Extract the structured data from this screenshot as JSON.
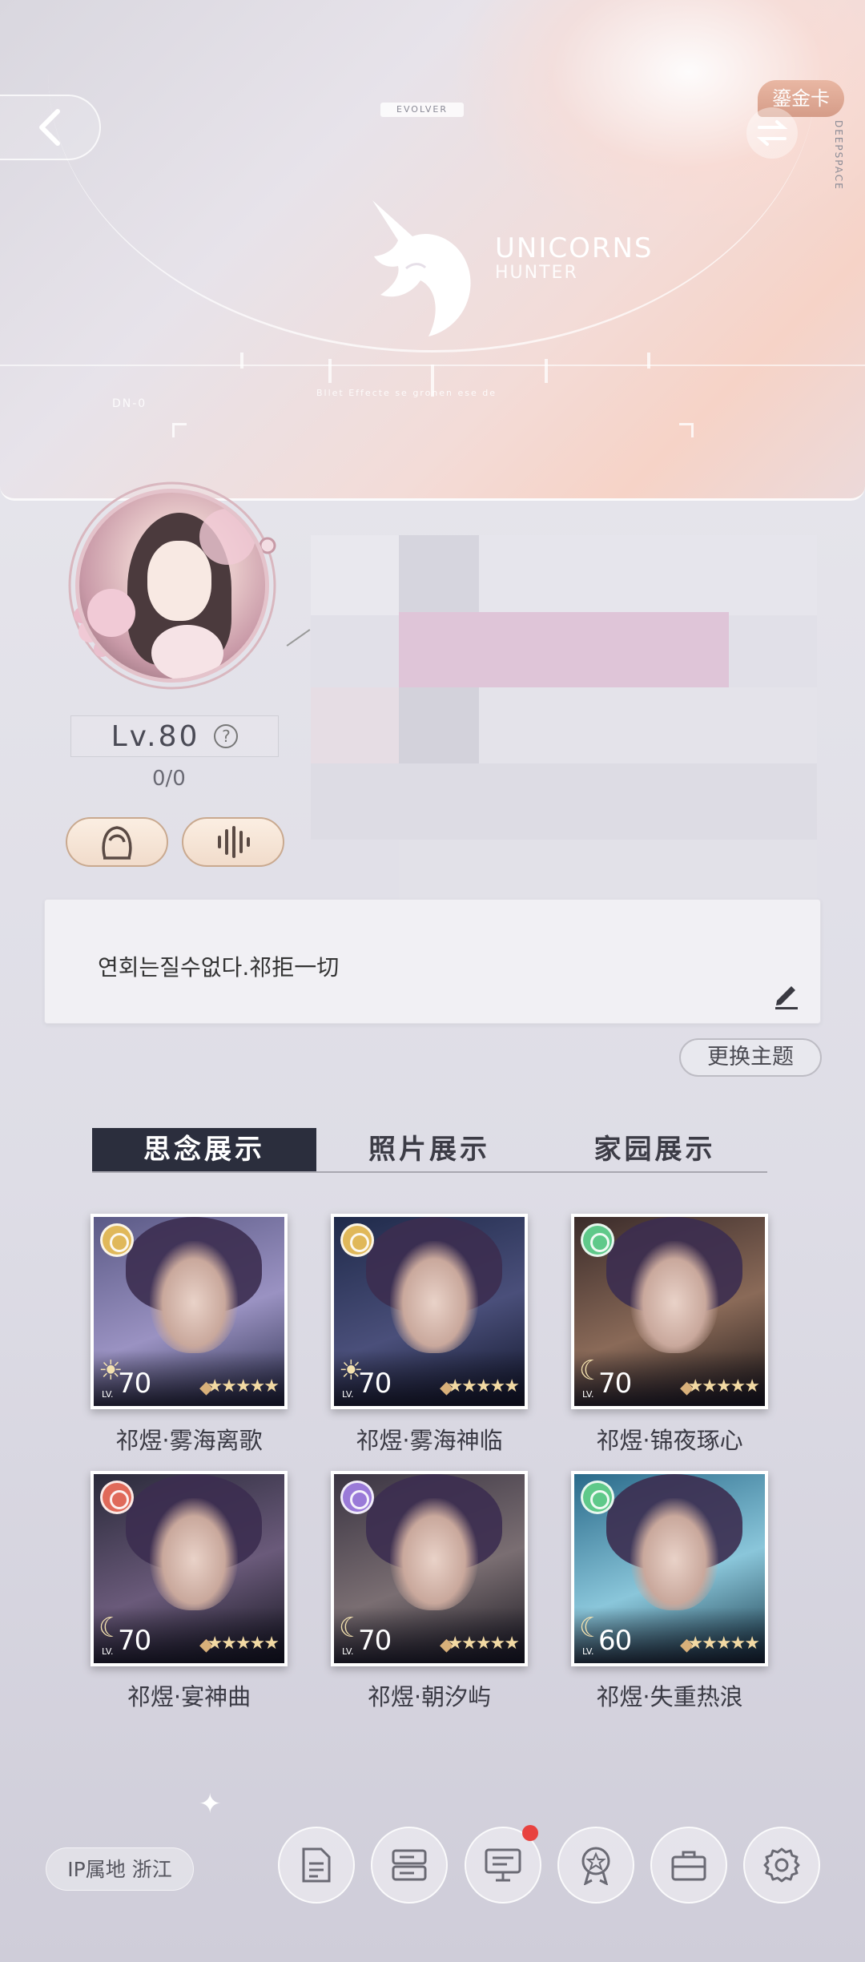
{
  "banner": {
    "evolver_tag": "EVOLVER",
    "logo_title": "UNICORNS",
    "logo_subtitle": "HUNTER",
    "gold_card_label": "鎏金卡",
    "side_text": "DEEPSPACE",
    "readout_left": "DN-0",
    "readout_mid": "Bllet Effecte se gronen ese de"
  },
  "profile": {
    "level": "Lv.80",
    "exp": "0/0"
  },
  "signature": {
    "text": "연회는질수없다.祁拒一切"
  },
  "theme_button": "更换主题",
  "tabs": [
    {
      "label": "思念展示",
      "active": true
    },
    {
      "label": "照片展示",
      "active": false
    },
    {
      "label": "家园展示",
      "active": false
    }
  ],
  "cards": [
    {
      "name": "祁煜·雾海离歌",
      "level": "70",
      "level_icon": "sun-icon",
      "stars": "★★★★★",
      "badge_color": "#e0b85a",
      "art": [
        "#5b5a86",
        "#9a92c2",
        "#2b2e4c"
      ]
    },
    {
      "name": "祁煜·雾海神临",
      "level": "70",
      "level_icon": "sun-icon",
      "stars": "★★★★★",
      "badge_color": "#e0b85a",
      "art": [
        "#1f2a4a",
        "#4a4f7a",
        "#0f1428"
      ]
    },
    {
      "name": "祁煜·锦夜琢心",
      "level": "70",
      "level_icon": "moon-icon",
      "stars": "★★★★★",
      "badge_color": "#5fc98a",
      "art": [
        "#3a2b2a",
        "#8a6a58",
        "#1c1616"
      ]
    },
    {
      "name": "祁煜·宴神曲",
      "level": "70",
      "level_icon": "moon-icon",
      "stars": "★★★★★",
      "badge_color": "#e06a5a",
      "art": [
        "#2a2a3a",
        "#6a5a7a",
        "#12121c"
      ]
    },
    {
      "name": "祁煜·朝汐屿",
      "level": "70",
      "level_icon": "moon-icon",
      "stars": "★★★★★",
      "badge_color": "#9a7ad8",
      "art": [
        "#3a3442",
        "#7a6e72",
        "#1a1820"
      ]
    },
    {
      "name": "祁煜·失重热浪",
      "level": "60",
      "level_icon": "moon-icon",
      "stars": "★★★★★",
      "badge_color": "#5fc98a",
      "art": [
        "#2a6a8a",
        "#8ac6da",
        "#183a4a"
      ]
    }
  ],
  "card_level_prefix": "LV.",
  "ip_location": "IP属地  浙江",
  "nav": [
    {
      "icon": "document-icon"
    },
    {
      "icon": "server-list-icon"
    },
    {
      "icon": "message-board-icon",
      "notification": true
    },
    {
      "icon": "medal-icon"
    },
    {
      "icon": "briefcase-icon"
    },
    {
      "icon": "settings-gear-icon"
    }
  ],
  "colors": {
    "tab_active_bg": "#2b2e3d",
    "notification_dot": "#e8423f",
    "gold_card_bg": "#d9a08b"
  }
}
